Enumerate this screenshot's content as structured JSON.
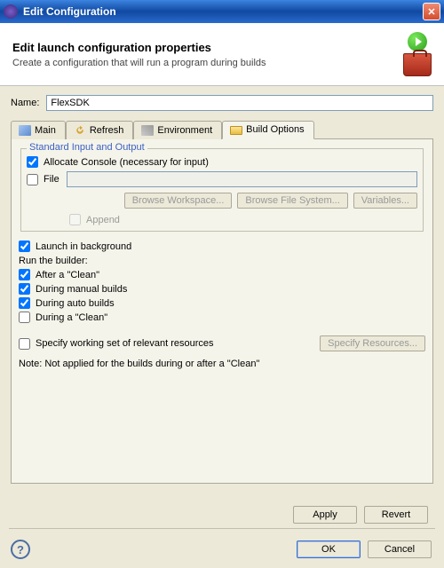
{
  "window": {
    "title": "Edit Configuration"
  },
  "header": {
    "title": "Edit launch configuration properties",
    "desc": "Create a configuration that will run a program during builds"
  },
  "name": {
    "label": "Name:",
    "value": "FlexSDK"
  },
  "tabs": {
    "main": "Main",
    "refresh": "Refresh",
    "environment": "Environment",
    "build": "Build Options"
  },
  "io": {
    "group": "Standard Input and Output",
    "allocate": "Allocate Console (necessary for input)",
    "file": "File",
    "browseWs": "Browse Workspace...",
    "browseFs": "Browse File System...",
    "vars": "Variables...",
    "append": "Append"
  },
  "opts": {
    "launchBg": "Launch in background",
    "runBuilder": "Run the builder:",
    "afterClean": "After a \"Clean\"",
    "manual": "During manual builds",
    "auto": "During auto builds",
    "duringClean": "During a \"Clean\""
  },
  "wset": {
    "specify": "Specify working set of relevant resources",
    "btn": "Specify Resources..."
  },
  "note": "Note: Not applied for the builds during or after a \"Clean\"",
  "buttons": {
    "apply": "Apply",
    "revert": "Revert",
    "ok": "OK",
    "cancel": "Cancel"
  }
}
